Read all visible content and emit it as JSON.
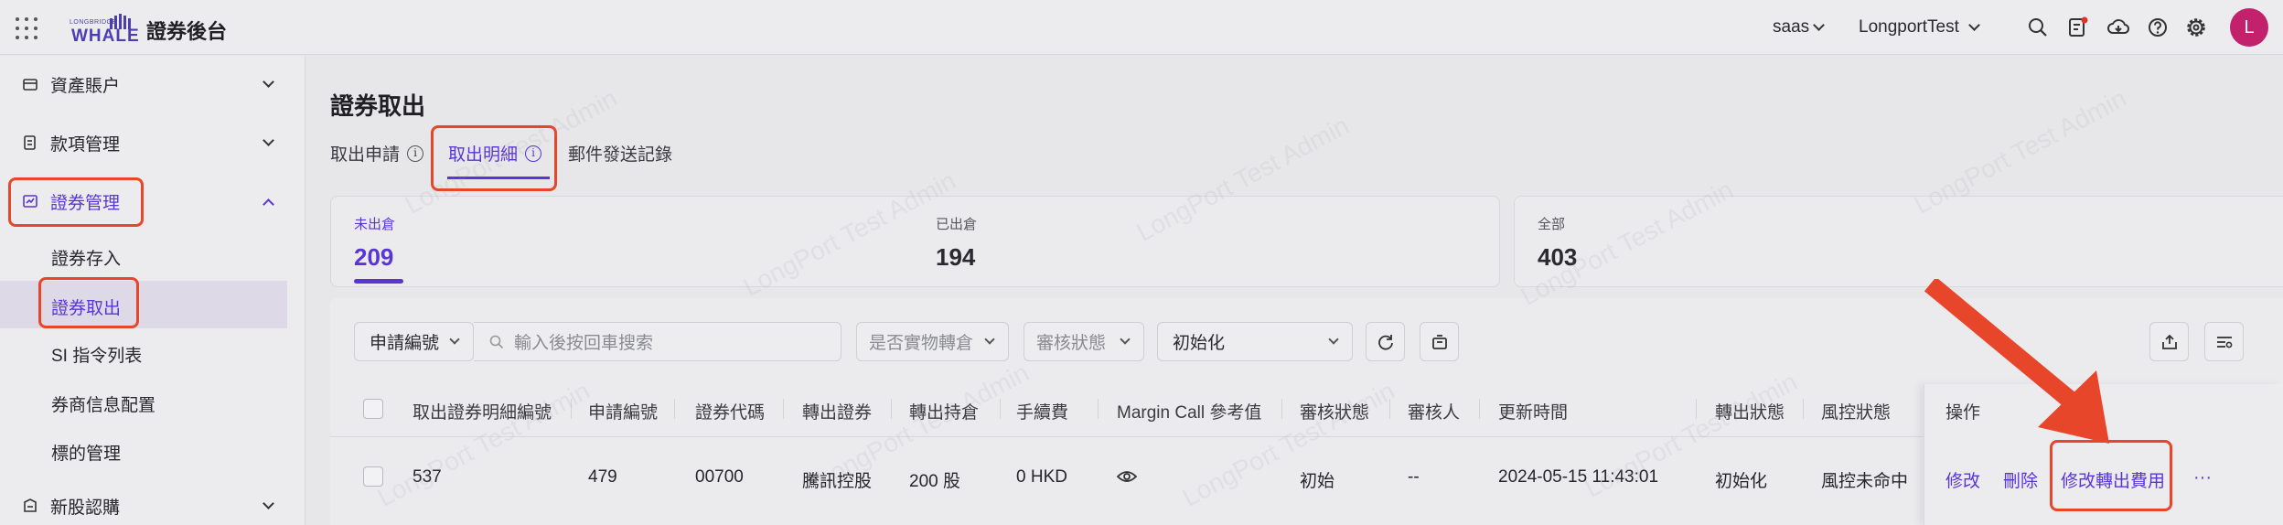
{
  "app": {
    "title": "證券後台",
    "logo_small": "LONGBRIDGE",
    "logo_text": "WHALE"
  },
  "topbar": {
    "tenant": "saas",
    "account": "LongportTest",
    "avatar_initial": "L"
  },
  "sidebar": {
    "groups": [
      {
        "label": "資產賬户"
      },
      {
        "label": "款項管理"
      },
      {
        "label": "證券管理"
      },
      {
        "label": "新股認購"
      }
    ],
    "sub_items": [
      {
        "label": "證券存入"
      },
      {
        "label": "證券取出"
      },
      {
        "label": "SI 指令列表"
      },
      {
        "label": "券商信息配置"
      },
      {
        "label": "標的管理"
      }
    ]
  },
  "page": {
    "title": "證券取出",
    "tabs": [
      {
        "label": "取出申請",
        "info": "i"
      },
      {
        "label": "取出明細",
        "info": "i"
      },
      {
        "label": "郵件發送記錄"
      }
    ]
  },
  "stats": [
    {
      "label": "未出倉",
      "value": "209"
    },
    {
      "label": "已出倉",
      "value": "194"
    },
    {
      "label": "全部",
      "value": "403"
    }
  ],
  "filters": {
    "search_type": "申請編號",
    "search_placeholder": "輸入後按回車搜索",
    "physical": "是否實物轉倉",
    "review_status": "審核狀態",
    "status": "初始化"
  },
  "table": {
    "columns": [
      "取出證券明細編號",
      "申請編號",
      "證券代碼",
      "轉出證券",
      "轉出持倉",
      "手續費",
      "Margin Call 參考值",
      "審核狀態",
      "審核人",
      "更新時間",
      "轉出狀態",
      "風控狀態",
      "操作"
    ],
    "row": {
      "id": "537",
      "application_no": "479",
      "code": "00700",
      "security": "騰訊控股",
      "holding": "200 股",
      "fee": "0 HKD",
      "review_status": "初始",
      "reviewer": "--",
      "updated": "2024-05-15 11:43:01",
      "transfer_status": "初始化",
      "risk_status": "風控未命中",
      "actions": {
        "edit": "修改",
        "delete": "刪除",
        "modify_fee": "修改轉出費用",
        "more": "···"
      }
    }
  },
  "watermark": "LongPort Test Admin",
  "colors": {
    "accent": "#5a35d6",
    "highlight": "#e8462a",
    "avatar": "#c4216c"
  }
}
